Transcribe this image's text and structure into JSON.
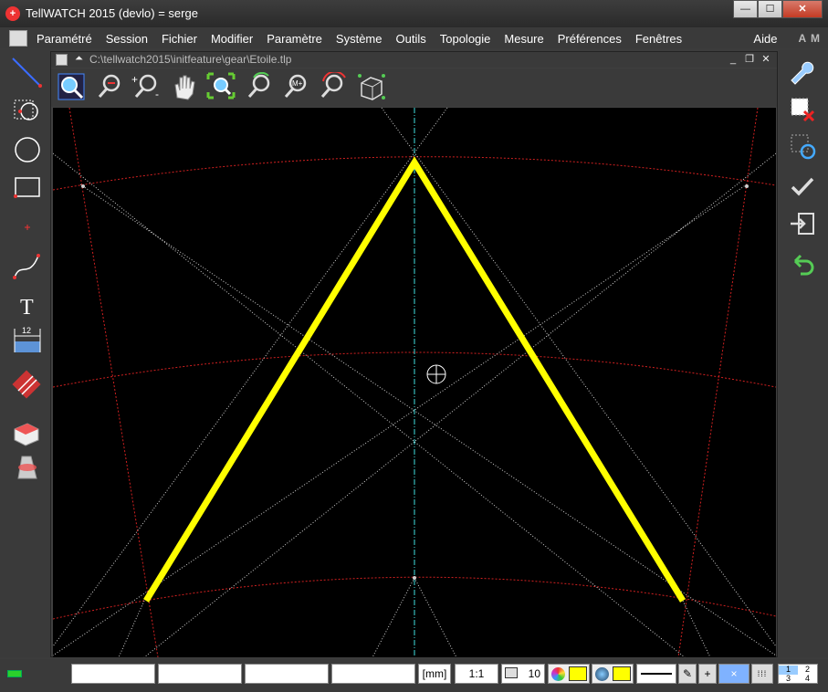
{
  "window": {
    "app_icon": "swiss-cross-icon",
    "title": "TellWATCH 2015  (devlo) = serge",
    "minimize": "—",
    "maximize": "☐",
    "close": "✕"
  },
  "menu": {
    "items": [
      "Paramétré",
      "Session",
      "Fichier",
      "Modifier",
      "Paramètre",
      "Système",
      "Outils",
      "Topologie",
      "Mesure",
      "Préférences",
      "Fenêtres"
    ],
    "help": "Aide",
    "brand": "A M"
  },
  "left_toolbar": {
    "tools": [
      "line-tool-icon",
      "point-circle-tool-icon",
      "circle-tool-icon",
      "rectangle-tool-icon",
      "point-tool-icon",
      "spline-tool-icon",
      "text-tool-icon",
      "dimension-tool-icon",
      "hatch-tool-icon",
      "extrude-tool-icon",
      "revolve-tool-icon"
    ],
    "text_glyph": "T",
    "dimension_value": "12"
  },
  "right_toolbar": {
    "tools": [
      "wrench-icon",
      "delete-selection-icon",
      "refresh-selection-icon",
      "check-icon",
      "import-icon",
      "undo-icon"
    ]
  },
  "document": {
    "path": "C:\\tellwatch2015\\initfeature\\gear\\Etoile.tlp",
    "minimize": "_",
    "restore": "❐",
    "close": "✕",
    "view_tools": [
      "zoom-window-icon",
      "zoom-out-icon",
      "zoom-in-out-icon",
      "pan-hand-icon",
      "zoom-fit-icon",
      "zoom-previous-icon",
      "zoom-memory-icon",
      "zoom-rotate-icon",
      "3d-view-cube-icon"
    ],
    "zoom_memory_label": "M+"
  },
  "canvas": {
    "background": "#000000",
    "profile_color": "#ffff00",
    "axis_color": "#40e0e0",
    "arc_color": "#d02020",
    "construction_color": "#cfcfcf"
  },
  "status": {
    "indicator_color": "#2bd12b",
    "fields": [
      "",
      "",
      "",
      ""
    ],
    "unit": "[mm]",
    "scale": "1:1",
    "layer_count": "10",
    "layer_color": "#ffff00",
    "line_color": "#ffff00",
    "snap_symbol": "×",
    "grid_layout": [
      "1",
      "2",
      "3",
      "4"
    ]
  }
}
